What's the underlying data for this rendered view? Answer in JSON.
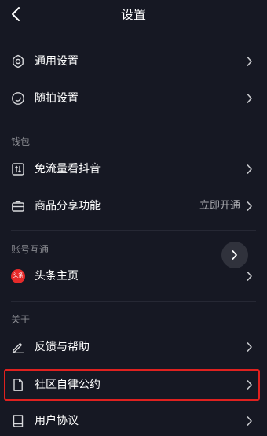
{
  "header": {
    "title": "设置"
  },
  "rows": {
    "general": {
      "label": "通用设置"
    },
    "snapshot": {
      "label": "随拍设置"
    },
    "free_data": {
      "label": "免流量看抖音"
    },
    "product_share": {
      "label": "商品分享功能",
      "right_text": "立即开通"
    },
    "toutiao": {
      "label": "头条主页",
      "badge_text": "头条"
    },
    "feedback": {
      "label": "反馈与帮助"
    },
    "community": {
      "label": "社区自律公约"
    },
    "user_agreement": {
      "label": "用户协议"
    }
  },
  "sections": {
    "wallet": "钱包",
    "accounts": "账号互通",
    "about": "关于"
  },
  "colors": {
    "background": "#161823",
    "highlight_border": "#e0211f",
    "toutiao_red": "#e52a2a",
    "secondary_text": "#a8a9ae"
  }
}
